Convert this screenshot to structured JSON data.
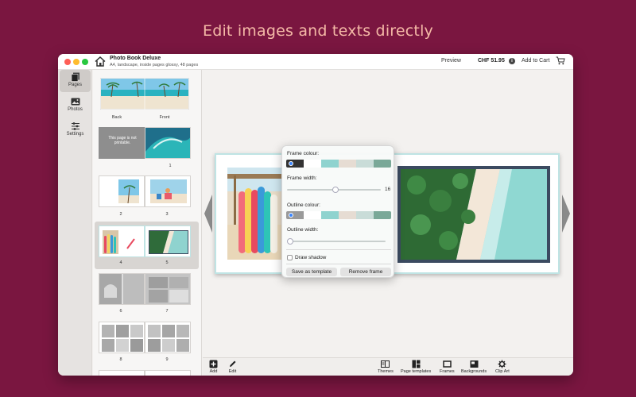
{
  "headline": "Edit images and texts directly",
  "colors": {
    "background": "#7a1640",
    "headline": "#f4b9a6",
    "accent": "#3a86ff",
    "frame": "#3b4a60"
  },
  "window": {
    "title": "Photo Book Deluxe",
    "subtitle": "A4, landscape, inside pages glossy, 48 pages",
    "preview_label": "Preview",
    "price": "CHF 51.95",
    "add_to_cart_label": "Add to Cart"
  },
  "sidebar": {
    "items": [
      {
        "label": "Pages",
        "icon": "pages-icon",
        "active": true
      },
      {
        "label": "Photos",
        "icon": "photos-icon",
        "active": false
      },
      {
        "label": "Settings",
        "icon": "settings-icon",
        "active": false
      }
    ]
  },
  "thumbnails": {
    "cover_labels": [
      "Back",
      "Front"
    ],
    "not_printable_text": "This page is not printable.",
    "page_labels": [
      "1",
      "2",
      "3",
      "4",
      "5",
      "6",
      "7",
      "8",
      "9"
    ]
  },
  "popover": {
    "frame_colour_label": "Frame colour:",
    "frame_swatches": [
      "#333333",
      "#ffffff",
      "#8fd3cf",
      "#e6dcd3",
      "#c9dcd8",
      "#7aa898"
    ],
    "frame_width_label": "Frame width:",
    "frame_width_value": "16",
    "frame_width_fraction": 0.52,
    "outline_colour_label": "Outline colour:",
    "outline_swatches": [
      "#9a9a9a",
      "#ffffff",
      "#8fd3cf",
      "#e6dcd3",
      "#c9dcd8",
      "#7aa898"
    ],
    "outline_width_label": "Outline width:",
    "outline_width_fraction": 0.0,
    "draw_shadow_label": "Draw shadow",
    "draw_shadow_checked": false,
    "save_template_label": "Save as template",
    "remove_frame_label": "Remove frame"
  },
  "toolbar": {
    "add_label": "Add",
    "edit_label": "Edit",
    "themes_label": "Themes",
    "page_templates_label": "Page templates",
    "frames_label": "Frames",
    "backgrounds_label": "Backgrounds",
    "clip_art_label": "Clip Art"
  }
}
